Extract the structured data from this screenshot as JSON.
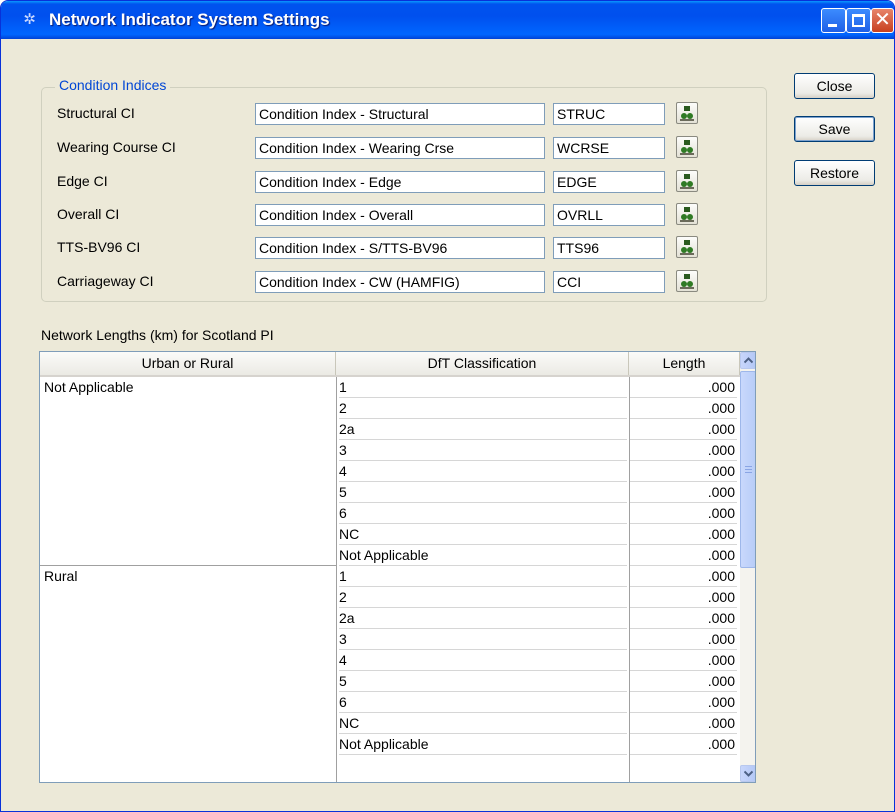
{
  "window": {
    "title": "Network Indicator System Settings",
    "title_icon": "gear-icon",
    "controls": {
      "minimize": "minimize-icon",
      "maximize": "maximize-icon",
      "close": "close-icon",
      "close_glyph": "✕"
    }
  },
  "condition_indices": {
    "group_title": "Condition Indices",
    "rows": [
      {
        "label": "Structural CI",
        "description": "Condition Index - Structural",
        "code": "STRUC"
      },
      {
        "label": "Wearing Course CI",
        "description": "Condition Index - Wearing Crse",
        "code": "WCRSE"
      },
      {
        "label": "Edge CI",
        "description": "Condition Index - Edge",
        "code": "EDGE"
      },
      {
        "label": "Overall CI",
        "description": "Condition Index - Overall",
        "code": "OVRLL"
      },
      {
        "label": "TTS-BV96 CI",
        "description": "Condition Index - S/TTS-BV96",
        "code": "TTS96"
      },
      {
        "label": "Carriageway CI",
        "description": "Condition Index - CW (HAMFIG)",
        "code": "CCI"
      }
    ],
    "lookup_icon": "binoculars-icon"
  },
  "buttons": {
    "close": "Close",
    "save": "Save",
    "restore": "Restore"
  },
  "network_lengths": {
    "label": "Network Lengths (km) for Scotland PI",
    "columns": [
      "Urban or Rural",
      "DfT Classification",
      "Length"
    ],
    "groups": [
      {
        "urban_or_rural": "Not Applicable",
        "rows": [
          {
            "dft": "1",
            "length": ".000"
          },
          {
            "dft": "2",
            "length": ".000"
          },
          {
            "dft": "2a",
            "length": ".000"
          },
          {
            "dft": "3",
            "length": ".000"
          },
          {
            "dft": "4",
            "length": ".000"
          },
          {
            "dft": "5",
            "length": ".000"
          },
          {
            "dft": "6",
            "length": ".000"
          },
          {
            "dft": "NC",
            "length": ".000"
          },
          {
            "dft": "Not Applicable",
            "length": ".000"
          }
        ]
      },
      {
        "urban_or_rural": "Rural",
        "rows": [
          {
            "dft": "1",
            "length": ".000"
          },
          {
            "dft": "2",
            "length": ".000"
          },
          {
            "dft": "2a",
            "length": ".000"
          },
          {
            "dft": "3",
            "length": ".000"
          },
          {
            "dft": "4",
            "length": ".000"
          },
          {
            "dft": "5",
            "length": ".000"
          },
          {
            "dft": "6",
            "length": ".000"
          },
          {
            "dft": "NC",
            "length": ".000"
          },
          {
            "dft": "Not Applicable",
            "length": ".000"
          }
        ]
      }
    ],
    "scroll_position": 0
  }
}
